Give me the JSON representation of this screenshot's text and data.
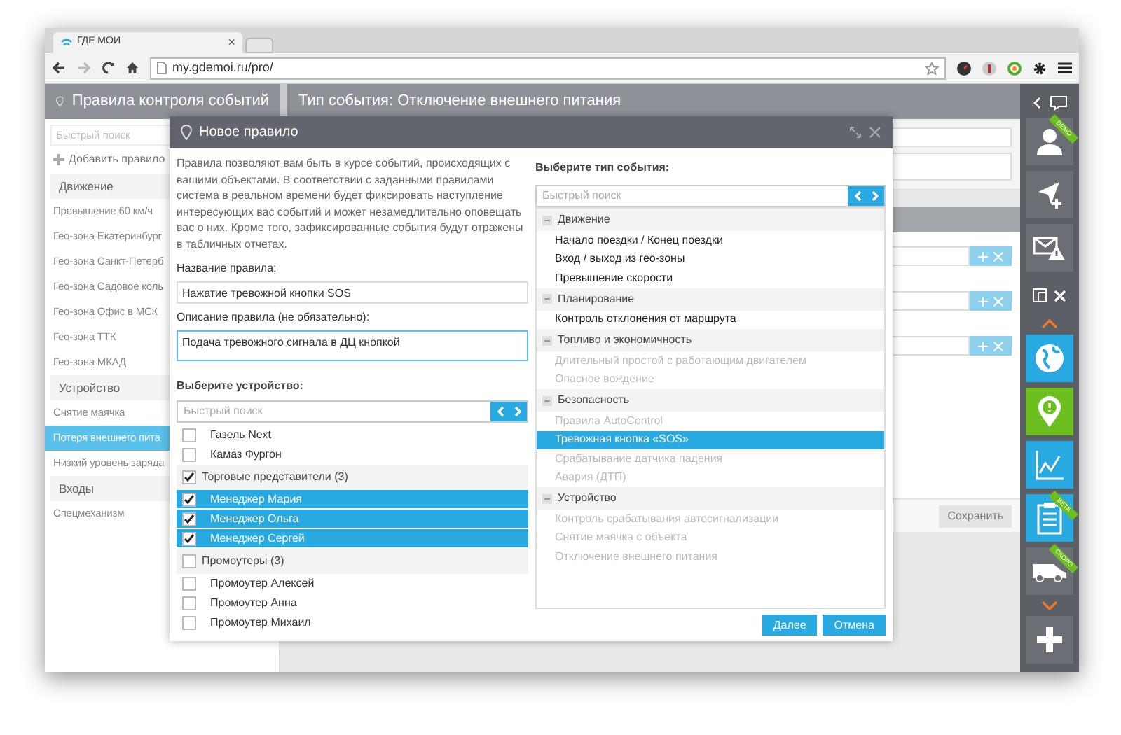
{
  "browser": {
    "tab_title": "ГДЕ МОИ",
    "tab_close": "×",
    "url": "my.gdemoi.ru/pro/"
  },
  "header": {
    "left_title": "Правила контроля событий",
    "right_title": "Тип события: Отключение внешнего питания"
  },
  "sidebar": {
    "search_placeholder": "Быстрый поиск",
    "add_label": "Добавить правило",
    "items": [
      {
        "kind": "group",
        "label": "Движение",
        "selected": false
      },
      {
        "kind": "item",
        "label": "Превышение 60 км/ч",
        "selected": false
      },
      {
        "kind": "item",
        "label": "Гео-зона Екатеринбург",
        "selected": false
      },
      {
        "kind": "item",
        "label": "Гео-зона Санкт-Петерб",
        "selected": false
      },
      {
        "kind": "item",
        "label": "Гео-зона Садовое коль",
        "selected": false
      },
      {
        "kind": "item",
        "label": "Гео-зона Офис в МСК",
        "selected": false
      },
      {
        "kind": "item",
        "label": "Гео-зона ТТК",
        "selected": false
      },
      {
        "kind": "item",
        "label": "Гео-зона МКАД",
        "selected": false
      },
      {
        "kind": "group",
        "label": "Устройство",
        "selected": false
      },
      {
        "kind": "item",
        "label": "Снятие маячка",
        "selected": false
      },
      {
        "kind": "item",
        "label": "Потеря внешнего пита",
        "selected": true
      },
      {
        "kind": "item",
        "label": "Низкий уровень заряда",
        "selected": false
      },
      {
        "kind": "group",
        "label": "Входы",
        "selected": false
      },
      {
        "kind": "item",
        "label": "Спецмеханизм",
        "selected": false
      }
    ]
  },
  "content": {
    "save_label": "Сохранить"
  },
  "modal": {
    "title": "Новое правило",
    "description": "Правила позволяют вам быть в курсе событий, происходящих с вашими объектами. В соответствии с заданными правилами система в реальном времени будет фиксировать наступление интересующих вас событий и может незамедлительно оповещать вас о них. Кроме того, зафиксированные события будут отражены в табличных отчетах.",
    "name_label": "Название правила:",
    "name_value": "Нажатие тревожной кнопки SOS",
    "desc_label": "Описание правила (не обязательно):",
    "desc_value": "Подача тревожного сигнала в ДЦ кнопкой",
    "device_label": "Выберите устройство:",
    "device_search_placeholder": "Быстрый поиск",
    "devices": [
      {
        "kind": "item",
        "label": "Газель Next",
        "checked": false,
        "selected": false
      },
      {
        "kind": "item",
        "label": "Камаз Фургон",
        "checked": false,
        "selected": false
      },
      {
        "kind": "group",
        "label": "Торговые представители (3)",
        "checked": true,
        "children": [
          {
            "kind": "item",
            "label": "Менеджер Мария",
            "checked": true,
            "selected": true
          },
          {
            "kind": "item",
            "label": "Менеджер Ольга",
            "checked": true,
            "selected": true
          },
          {
            "kind": "item",
            "label": "Менеджер Сергей",
            "checked": true,
            "selected": true
          }
        ]
      },
      {
        "kind": "group",
        "label": "Промоутеры (3)",
        "checked": false,
        "children": [
          {
            "kind": "item",
            "label": "Промоутер Алексей",
            "checked": false,
            "selected": false
          },
          {
            "kind": "item",
            "label": "Промоутер Анна",
            "checked": false,
            "selected": false
          },
          {
            "kind": "item",
            "label": "Промоутер Михаил",
            "checked": false,
            "selected": false
          }
        ]
      }
    ],
    "event_label": "Выберите тип события:",
    "event_search_placeholder": "Быстрый поиск",
    "events": [
      {
        "label": "Движение",
        "expanded": true,
        "children": [
          {
            "label": "Начало поездки / Конец поездки",
            "disabled": false,
            "selected": false
          },
          {
            "label": "Вход / выход из гео-зоны",
            "disabled": false,
            "selected": false
          },
          {
            "label": "Превышение скорости",
            "disabled": false,
            "selected": false
          }
        ]
      },
      {
        "label": "Планирование",
        "expanded": true,
        "children": [
          {
            "label": "Контроль отклонения от маршрута",
            "disabled": false,
            "selected": false
          }
        ]
      },
      {
        "label": "Топливо и экономичность",
        "expanded": true,
        "children": [
          {
            "label": "Длительный простой с работающим двигателем",
            "disabled": true,
            "selected": false
          },
          {
            "label": "Опасное вождение",
            "disabled": true,
            "selected": false
          }
        ]
      },
      {
        "label": "Безопасность",
        "expanded": true,
        "children": [
          {
            "label": "Правила AutoControl",
            "disabled": true,
            "selected": false
          },
          {
            "label": "Тревожная кнопка «SOS»",
            "disabled": false,
            "selected": true
          },
          {
            "label": "Срабатывание датчика падения",
            "disabled": true,
            "selected": false
          },
          {
            "label": "Авария (ДТП)",
            "disabled": true,
            "selected": false
          }
        ]
      },
      {
        "label": "Устройство",
        "expanded": true,
        "children": [
          {
            "label": "Контроль срабатывания автосигнализации",
            "disabled": true,
            "selected": false
          },
          {
            "label": "Снятие маячка с объекта",
            "disabled": true,
            "selected": false
          },
          {
            "label": "Отключение внешнего питания",
            "disabled": true,
            "selected": false
          }
        ]
      }
    ],
    "buttons": [
      "Далее",
      "Отмена"
    ]
  },
  "rail": {
    "tiles": [
      {
        "kind": "user",
        "color": "#6b6e75",
        "ribbon": "DEMO"
      },
      {
        "kind": "navigate",
        "color": "#6b6e75"
      },
      {
        "kind": "mail-alert",
        "color": "#6b6e75"
      },
      {
        "kind": "layout"
      },
      {
        "kind": "chevron-up"
      },
      {
        "kind": "globe",
        "color": "#29a9e1"
      },
      {
        "kind": "pin-alert",
        "color": "#6cbf1f"
      },
      {
        "kind": "chart",
        "color": "#29a9e1"
      },
      {
        "kind": "clipboard",
        "color": "#29a9e1",
        "ribbon": "BETA"
      },
      {
        "kind": "van",
        "color": "#6b6e75",
        "ribbon": "СКОРО"
      },
      {
        "kind": "chevron-down"
      },
      {
        "kind": "plus",
        "color": "#6b6e75"
      }
    ]
  }
}
